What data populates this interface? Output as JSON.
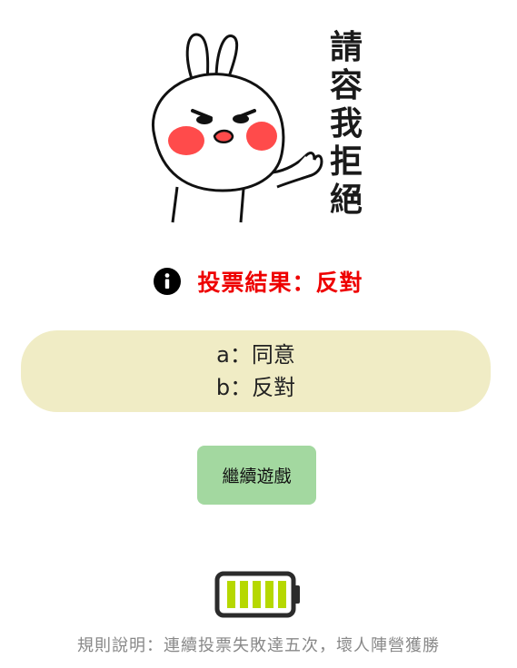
{
  "sticker": {
    "caption_chars": [
      "請",
      "容",
      "我",
      "拒",
      "絕"
    ]
  },
  "result": {
    "icon": "info-icon",
    "text": "投票結果：反對",
    "color": "#ee0000"
  },
  "options": {
    "a": "a：同意",
    "b": "b：反對",
    "background": "#f0ecc5"
  },
  "continue_button": {
    "label": "繼續遊戲",
    "color": "#a3d8a0"
  },
  "battery": {
    "icon": "battery-icon",
    "level": 1.0,
    "fill_color": "#b6d800"
  },
  "rules": {
    "text": "規則說明：連續投票失敗達五次，壞人陣營獲勝"
  }
}
